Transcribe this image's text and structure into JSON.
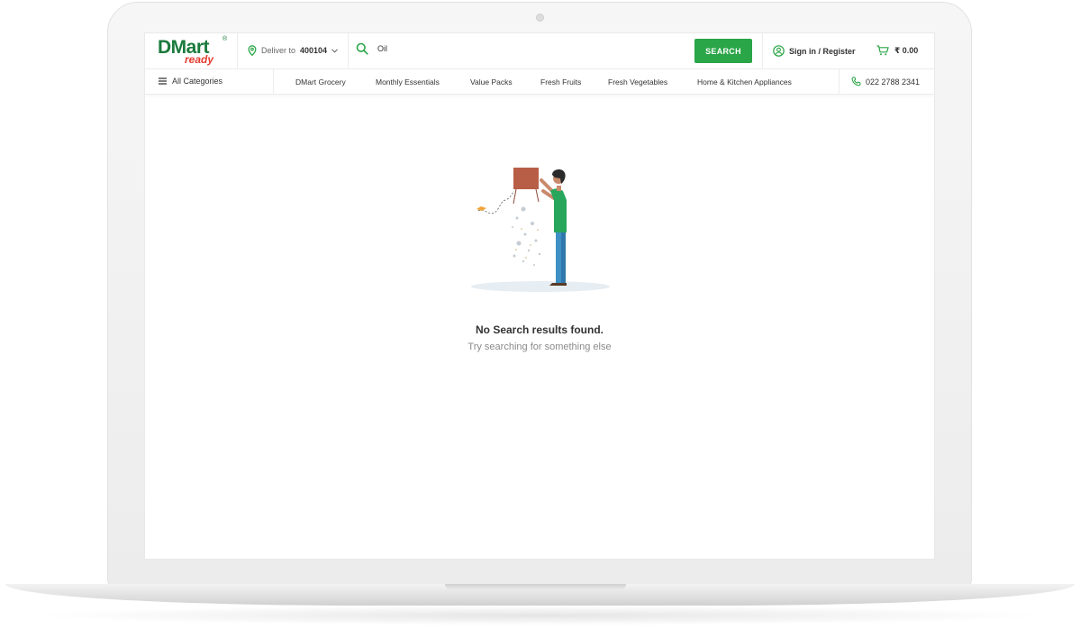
{
  "brand": {
    "name": "DMart",
    "tagline": "ready",
    "reg": "®"
  },
  "deliver": {
    "label": "Deliver to",
    "pincode": "400104"
  },
  "search": {
    "value": "Oil",
    "button": "SEARCH"
  },
  "account": {
    "label": "Sign in / Register"
  },
  "cart": {
    "amount": "₹ 0.00"
  },
  "nav": {
    "all_categories": "All Categories",
    "items": [
      "DMart Grocery",
      "Monthly Essentials",
      "Value Packs",
      "Fresh Fruits",
      "Fresh Vegetables",
      "Home & Kitchen Appliances"
    ],
    "phone": "022 2788 2341"
  },
  "empty": {
    "title": "No Search results found.",
    "subtitle": "Try searching for something else"
  },
  "colors": {
    "accent": "#2aa547",
    "brand_green": "#1a7a3c",
    "brand_red": "#e53b2f"
  }
}
